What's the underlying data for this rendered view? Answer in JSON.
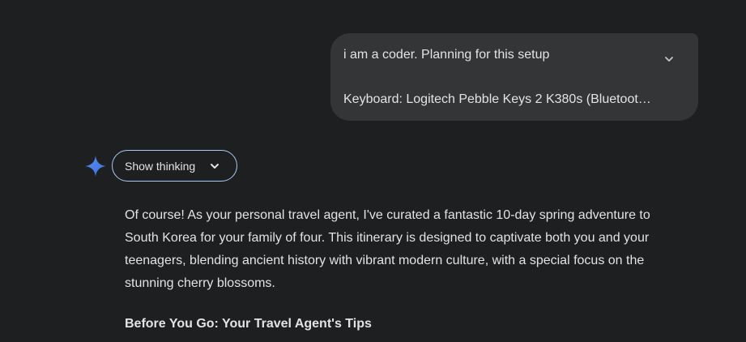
{
  "user_message": {
    "line1": "i am a coder. Planning for this setup",
    "line2": "Keyboard: Logitech Pebble Keys 2 K380s (Bluetoot…",
    "expand_icon": "chevron-down-icon"
  },
  "assistant": {
    "avatar_icon": "gemini-spark-icon",
    "show_thinking_label": "Show thinking",
    "show_thinking_icon": "chevron-down-icon",
    "response_paragraph": "Of course! As your personal travel agent, I've curated a fantastic 10-day spring adventure to South Korea for your family of four. This itinerary is designed to captivate both you and your teenagers, blending ancient history with vibrant modern culture, with a special focus on the stunning cherry blossoms.",
    "section_heading": "Before You Go: Your Travel Agent's Tips"
  },
  "colors": {
    "background": "#1e1f20",
    "user_bubble": "#333537",
    "text": "#e3e3e3",
    "button_border": "#a8c7fa",
    "spark_blue": "#4285f4"
  }
}
